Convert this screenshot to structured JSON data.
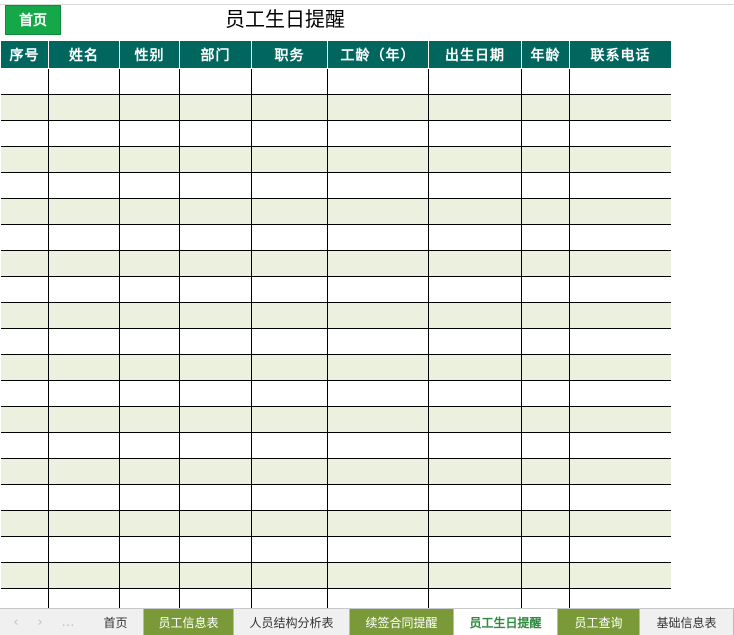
{
  "header": {
    "home_button": "首页",
    "title": "员工生日提醒"
  },
  "table": {
    "columns": [
      "序号",
      "姓名",
      "性别",
      "部门",
      "职务",
      "工龄（年）",
      "出生日期",
      "年龄",
      "联系电话"
    ],
    "row_count": 21,
    "colors": {
      "header_bg": "#00665e",
      "stripe": "#ebf1de"
    }
  },
  "sheet_tabs": {
    "nav_prev": "‹",
    "nav_next": "›",
    "nav_more": "…",
    "tabs": [
      {
        "label": "首页",
        "style": "plain"
      },
      {
        "label": "员工信息表",
        "style": "green"
      },
      {
        "label": "人员结构分析表",
        "style": "plain"
      },
      {
        "label": "续签合同提醒",
        "style": "green"
      },
      {
        "label": "员工生日提醒",
        "style": "active"
      },
      {
        "label": "员工查询",
        "style": "green"
      },
      {
        "label": "基础信息表",
        "style": "plain"
      }
    ]
  }
}
